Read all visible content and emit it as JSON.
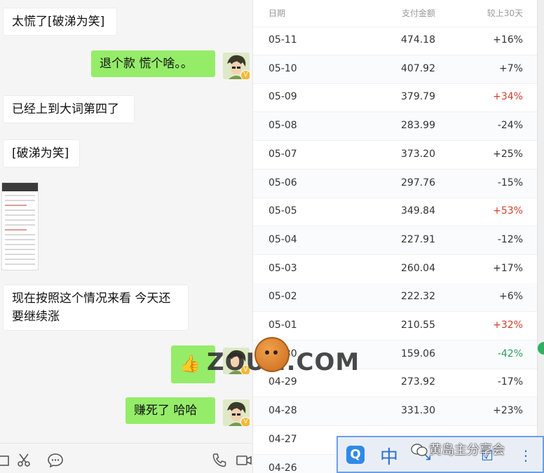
{
  "chat": {
    "messages": [
      {
        "side": "left",
        "text": "太慌了[破涕为笑]"
      },
      {
        "side": "right",
        "text": "退个款 慌个啥。。"
      },
      {
        "side": "left",
        "text": "已经上到大词第四了"
      },
      {
        "side": "left",
        "text": "[破涕为笑]"
      },
      {
        "side": "left",
        "text": "现在按照这个情况来看 今天还要继续涨"
      },
      {
        "side": "right",
        "text": "👍"
      },
      {
        "side": "right",
        "text": "赚死了  哈哈"
      }
    ],
    "avatar_badge": "V"
  },
  "stats": {
    "headers": {
      "date": "日期",
      "amount": "支付金额",
      "change": "较上30天"
    },
    "rows": [
      {
        "date": "05-11",
        "amount": "474.18",
        "change": "+16%",
        "tone": "neutral"
      },
      {
        "date": "05-10",
        "amount": "407.92",
        "change": "+7%",
        "tone": "neutral"
      },
      {
        "date": "05-09",
        "amount": "379.79",
        "change": "+34%",
        "tone": "red"
      },
      {
        "date": "05-08",
        "amount": "283.99",
        "change": "-24%",
        "tone": "neutral"
      },
      {
        "date": "05-07",
        "amount": "373.20",
        "change": "+25%",
        "tone": "neutral"
      },
      {
        "date": "05-06",
        "amount": "297.76",
        "change": "-15%",
        "tone": "neutral"
      },
      {
        "date": "05-05",
        "amount": "349.84",
        "change": "+53%",
        "tone": "red"
      },
      {
        "date": "05-04",
        "amount": "227.91",
        "change": "-12%",
        "tone": "neutral"
      },
      {
        "date": "05-03",
        "amount": "260.04",
        "change": "+17%",
        "tone": "neutral"
      },
      {
        "date": "05-02",
        "amount": "222.32",
        "change": "+6%",
        "tone": "neutral"
      },
      {
        "date": "05-01",
        "amount": "210.55",
        "change": "+32%",
        "tone": "red"
      },
      {
        "date": "04-30",
        "amount": "159.06",
        "change": "-42%",
        "tone": "green"
      },
      {
        "date": "04-29",
        "amount": "273.92",
        "change": "-17%",
        "tone": "neutral"
      },
      {
        "date": "04-28",
        "amount": "331.30",
        "change": "+23%",
        "tone": "neutral"
      },
      {
        "date": "04-27",
        "amount": "",
        "change": "",
        "tone": "neutral"
      },
      {
        "date": "04-26",
        "amount": "",
        "change": "",
        "tone": "neutral"
      }
    ]
  },
  "watermark": {
    "site": "ZOUN.COM",
    "caption": "黄岛主分享会"
  },
  "ime": {
    "zh": "中"
  },
  "icons": {
    "scissors": "scissors-icon",
    "chat": "chat-bubble-icon",
    "phone": "phone-icon",
    "video": "video-icon",
    "ime_search": "ime-search-icon",
    "ime_dots": "ime-punctuation-icon",
    "ime_edit": "ime-edit-icon"
  },
  "colors": {
    "right_bubble": "#95ec69",
    "red": "#d23c2b",
    "green": "#2f9e62",
    "ime_border": "#6aa0e8"
  }
}
